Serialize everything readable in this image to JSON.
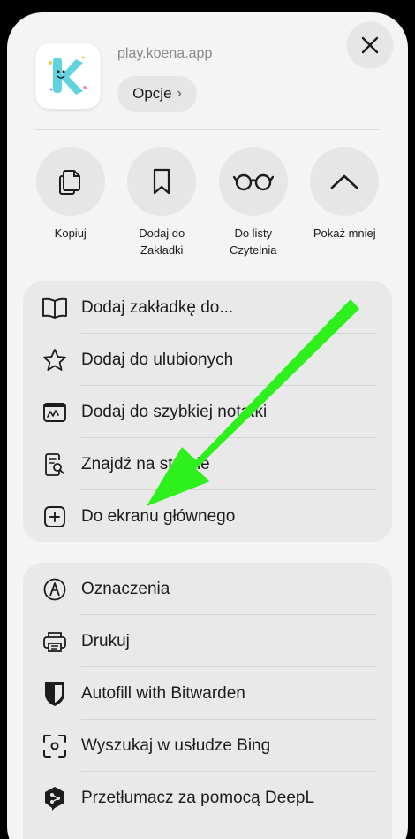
{
  "header": {
    "domain": "play.koena.app",
    "options_label": "Opcje",
    "options_chevron": "›"
  },
  "actions": [
    {
      "label": "Kopiuj",
      "icon": "copy-icon"
    },
    {
      "label": "Dodaj do\nZakładki",
      "icon": "bookmark-icon"
    },
    {
      "label": "Do listy\nCzytelnia",
      "icon": "reading-glasses-icon"
    },
    {
      "label": "Pokaż mniej",
      "icon": "chevron-up-icon"
    }
  ],
  "menu_group_1": [
    {
      "label": "Dodaj zakładkę do...",
      "icon": "book-icon"
    },
    {
      "label": "Dodaj do ulubionych",
      "icon": "star-icon"
    },
    {
      "label": "Dodaj do szybkiej notatki",
      "icon": "quick-note-icon"
    },
    {
      "label": "Znajdź na stronie",
      "icon": "find-on-page-icon"
    },
    {
      "label": "Do ekranu głównego",
      "icon": "add-square-icon"
    }
  ],
  "menu_group_2": [
    {
      "label": "Oznaczenia",
      "icon": "markup-icon"
    },
    {
      "label": "Drukuj",
      "icon": "printer-icon"
    },
    {
      "label": "Autofill with Bitwarden",
      "icon": "bitwarden-shield-icon"
    },
    {
      "label": "Wyszukaj w usłudze Bing",
      "icon": "visual-search-icon"
    },
    {
      "label": "Przetłumacz za pomocą DeepL",
      "icon": "deepl-icon"
    }
  ],
  "colors": {
    "sheet_bg": "#f4f4f4",
    "group_bg": "#e9e9e9",
    "arrow": "#2df01c"
  }
}
